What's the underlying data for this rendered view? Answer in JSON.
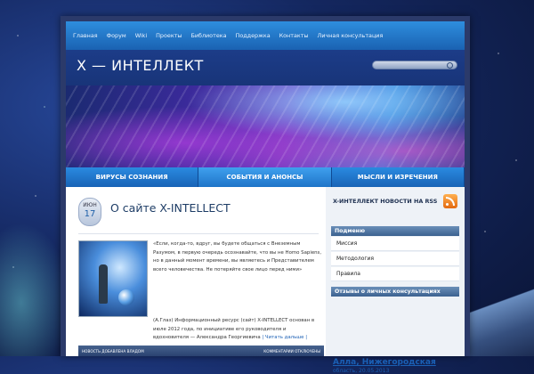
{
  "nav": {
    "items": [
      "Главная",
      "Форум",
      "Wiki",
      "Проекты",
      "Библиотека",
      "Поддержка",
      "Контакты",
      "Личная консультация"
    ]
  },
  "header": {
    "site_title": "X — ИНТЕЛЛЕКТ"
  },
  "categories": [
    "ВИРУСЫ СОЗНАНИЯ",
    "СОБЫТИЯ И АНОНСЫ",
    "МЫСЛИ И ИЗРЕЧЕНИЯ"
  ],
  "post": {
    "date_month": "ИЮН",
    "date_day": "17",
    "title": "О сайте X-INTELLECT",
    "quote": "«Если, когда-то, вдруг, вы будете общаться с Внеземным Разумом, в первую очередь осознавайте, что вы не Homo Sapiens, но в данный момент времени, вы являетесь и Представителем всего человечества. Не потеряйте свое лицо перед ними»",
    "paragraph": "(А.Глаз) Информационный ресурс (сайт) X-INTELLECT основан в июле 2012 года, по инициативе его руководителя и вдохновителя — Александра Георгиевича",
    "read_more": "| Читать дальше |",
    "meta_left": "НОВОСТЬ ДОБАВЛЕНА ВЛАДОМ",
    "meta_right": "КОММЕНТАРИИ ОТКЛЮЧЕНЫ"
  },
  "sidebar": {
    "rss_heading": "X-ИНТЕЛЛЕКТ НОВОСТИ НА RSS",
    "menu_title": "Подменю",
    "menu_items": [
      "Миссия",
      "Методология",
      "Правила"
    ],
    "reviews_title": "Отзывы о личных консультациях",
    "testimonial_name": "Алла, Нижегородская",
    "testimonial_sub": "область, 20.05.2013"
  },
  "colors": {
    "nav_blue": "#1f74c8",
    "link_blue": "#1a5fb4",
    "rss_orange": "#e36a10"
  }
}
